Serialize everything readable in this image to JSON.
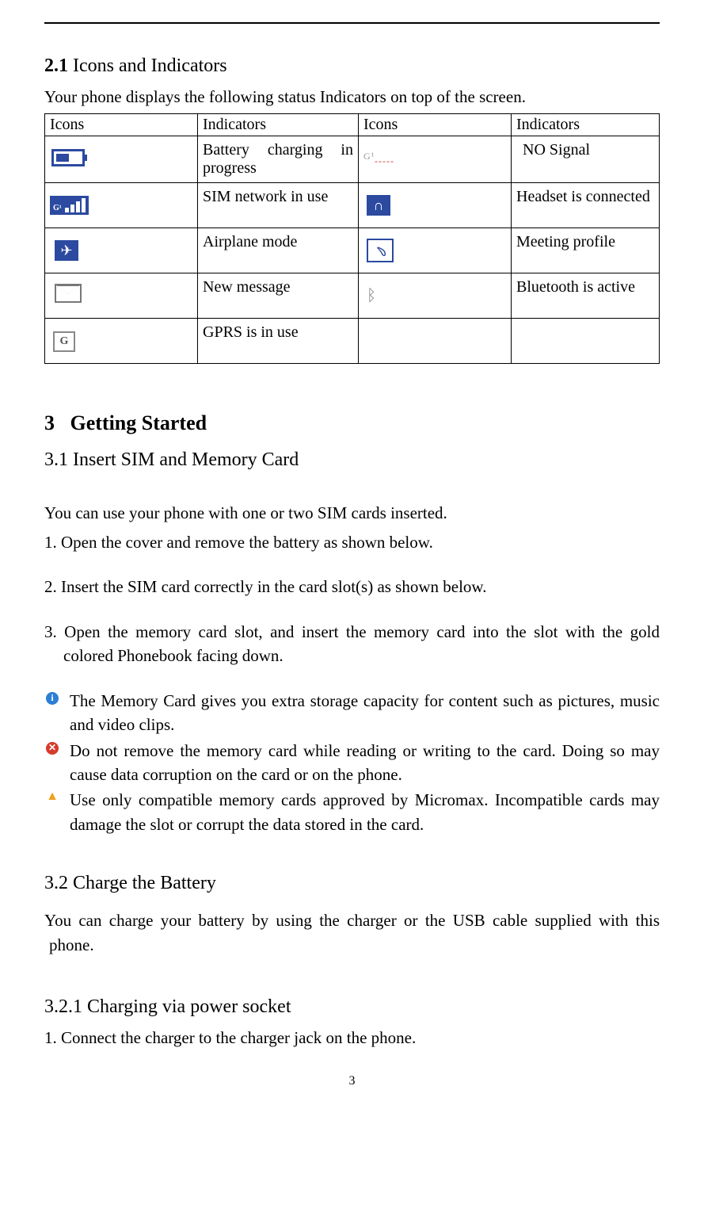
{
  "page_number": "3",
  "section21": {
    "num": "2.1",
    "title": "Icons and Indicators",
    "intro": "Your phone displays the following status Indicators on top of the screen.",
    "headers": [
      "Icons",
      "Indicators",
      "Icons",
      "Indicators"
    ],
    "rows": [
      {
        "left": "Battery charging in progress",
        "right": "NO Signal"
      },
      {
        "left": "SIM network in use",
        "right": "Headset is connected"
      },
      {
        "left": "Airplane mode",
        "right": "Meeting profile"
      },
      {
        "left": "New message",
        "right": "Bluetooth is active"
      },
      {
        "left": "GPRS is in use",
        "right": ""
      }
    ]
  },
  "section3": {
    "num": "3",
    "title": "Getting Started"
  },
  "section31": {
    "heading": "3.1 Insert SIM and Memory Card",
    "p1": "You can use your phone with one or two SIM cards inserted.",
    "step1": "1. Open the cover and remove the battery as shown below.",
    "step2": "2. Insert the SIM card correctly in the card slot(s) as shown below.",
    "step3": "3. Open the memory card slot, and insert the memory card into the slot with the gold colored Phonebook facing down.",
    "note1": "The Memory Card gives you extra storage capacity for content such as pictures, music and video clips.",
    "note2": "Do not remove the memory card while reading or writing to the card. Doing so may cause data corruption on the card or on the phone.",
    "note3": "Use only compatible memory cards approved by Micromax. Incompatible cards may damage the slot or corrupt the data stored in the card."
  },
  "section32": {
    "heading": "3.2 Charge the Battery",
    "p1": "You can charge your battery by using the charger or the USB cable supplied with this phone."
  },
  "section321": {
    "heading": "3.2.1 Charging via power socket",
    "step1": "1. Connect the charger to the charger jack on the phone."
  }
}
